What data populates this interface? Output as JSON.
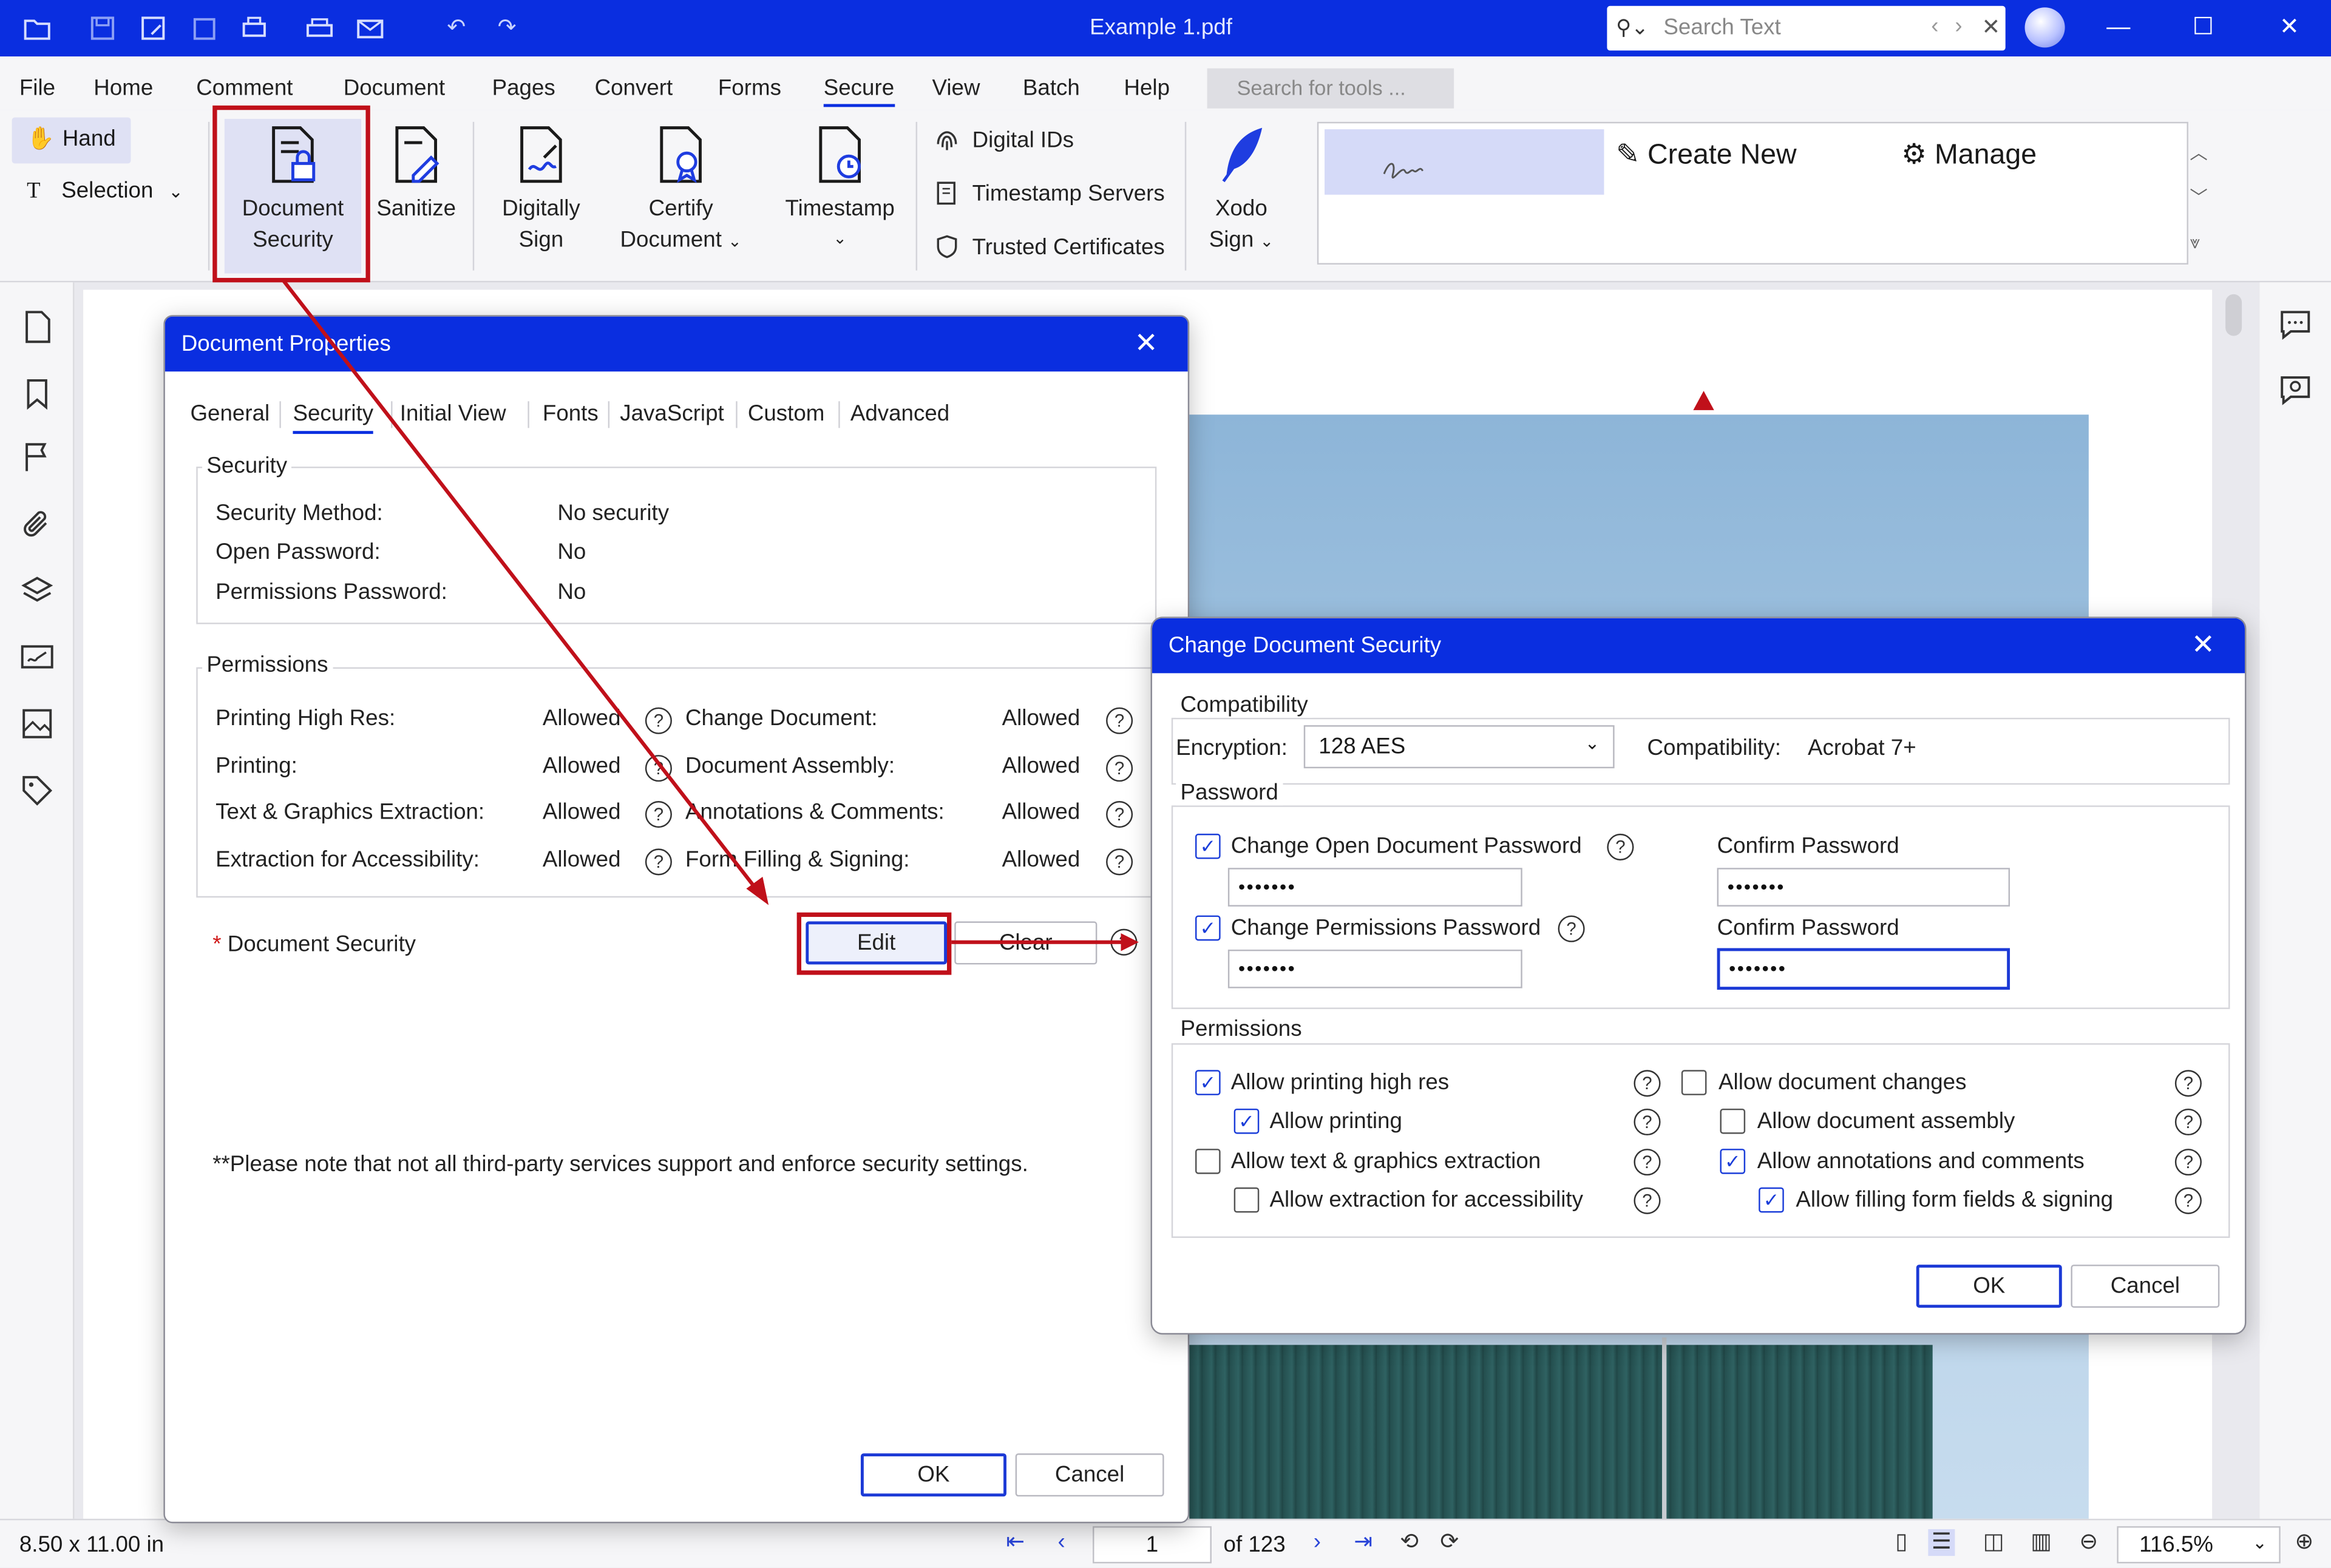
{
  "window": {
    "title": "Example 1.pdf",
    "search_placeholder": "Search Text"
  },
  "menu": [
    "File",
    "Home",
    "Comment",
    "Document",
    "Pages",
    "Convert",
    "Forms",
    "Secure",
    "View",
    "Batch",
    "Help"
  ],
  "menu_active": "Secure",
  "tool_search_placeholder": "Search for tools ...",
  "ribbon": {
    "hand": "Hand",
    "selection": "Selection",
    "document_security": [
      "Document",
      "Security"
    ],
    "sanitize": "Sanitize",
    "digitally_sign": [
      "Digitally",
      "Sign"
    ],
    "certify_document": [
      "Certify",
      "Document"
    ],
    "timestamp": "Timestamp",
    "digital_ids": "Digital IDs",
    "timestamp_servers": "Timestamp Servers",
    "trusted_certificates": "Trusted Certificates",
    "xodo_sign": [
      "Xodo",
      "Sign"
    ],
    "create_new": "Create New",
    "manage": "Manage"
  },
  "doc_props": {
    "title": "Document Properties",
    "tabs": [
      "General",
      "Security",
      "Initial View",
      "Fonts",
      "JavaScript",
      "Custom",
      "Advanced"
    ],
    "active_tab": "Security",
    "security_group": "Security",
    "security_rows": [
      {
        "label": "Security Method:",
        "value": "No security"
      },
      {
        "label": "Open Password:",
        "value": "No"
      },
      {
        "label": "Permissions Password:",
        "value": "No"
      }
    ],
    "permissions_group": "Permissions",
    "perm_left": [
      {
        "label": "Printing High Res:",
        "value": "Allowed"
      },
      {
        "label": "Printing:",
        "value": "Allowed"
      },
      {
        "label": "Text & Graphics Extraction:",
        "value": "Allowed"
      },
      {
        "label": "Extraction for Accessibility:",
        "value": "Allowed"
      }
    ],
    "perm_right": [
      {
        "label": "Change Document:",
        "value": "Allowed"
      },
      {
        "label": "Document Assembly:",
        "value": "Allowed"
      },
      {
        "label": "Annotations & Comments:",
        "value": "Allowed"
      },
      {
        "label": "Form Filling & Signing:",
        "value": "Allowed"
      }
    ],
    "doc_security_label": "Document Security",
    "required_mark": "*",
    "edit": "Edit",
    "clear": "Clear",
    "note": "**Please note that not all third-party services support and enforce security settings.",
    "ok": "OK",
    "cancel": "Cancel"
  },
  "change_sec": {
    "title": "Change Document Security",
    "compat_group": "Compatibility",
    "encryption_label": "Encryption:",
    "encryption_value": "128 AES",
    "compatibility_label": "Compatibility:",
    "compatibility_value": "Acrobat 7+",
    "password_group": "Password",
    "change_open": "Change Open Document Password",
    "change_perms": "Change Permissions Password",
    "confirm_1": "Confirm Password",
    "confirm_2": "Confirm Password",
    "pw_mask": "•••••••",
    "permissions_group": "Permissions",
    "perms_left": [
      {
        "label": "Allow printing high res",
        "checked": true
      },
      {
        "label": "Allow printing",
        "checked": true
      },
      {
        "label": "Allow text & graphics extraction",
        "checked": false
      },
      {
        "label": "Allow extraction for accessibility",
        "checked": false
      }
    ],
    "perms_right": [
      {
        "label": "Allow document changes",
        "checked": false
      },
      {
        "label": "Allow document assembly",
        "checked": false
      },
      {
        "label": "Allow annotations and comments",
        "checked": true
      },
      {
        "label": "Allow filling form fields & signing",
        "checked": true
      }
    ],
    "ok": "OK",
    "cancel": "Cancel"
  },
  "status": {
    "page_size": "8.50 x 11.00 in",
    "current_page": "1",
    "page_count": "of 123",
    "zoom": "116.5%"
  },
  "colors": {
    "accent": "#0a2ee0",
    "annotation_red": "#c0101a"
  }
}
